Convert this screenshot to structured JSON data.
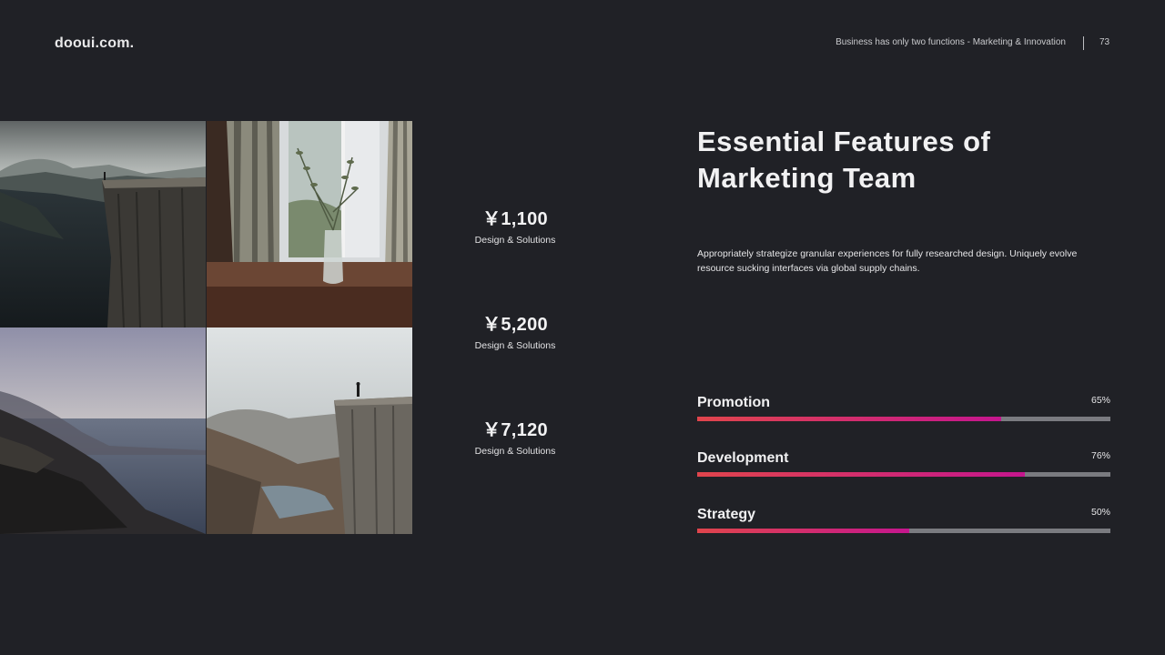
{
  "header": {
    "logo": "dooui.com.",
    "tagline": "Business has only two functions - Marketing & Innovation",
    "page_number": "73"
  },
  "photos": [
    {
      "name": "cliff-lake-photo"
    },
    {
      "name": "window-vase-photo"
    },
    {
      "name": "coast-mountains-photo"
    },
    {
      "name": "cliff-valley-photo"
    }
  ],
  "prices": [
    {
      "amount": "￥1,100",
      "caption": "Design & Solutions"
    },
    {
      "amount": "￥5,200",
      "caption": "Design & Solutions"
    },
    {
      "amount": "￥7,120",
      "caption": "Design & Solutions"
    }
  ],
  "main": {
    "title_line1": "Essential Features of",
    "title_line2": "Marketing Team",
    "description": "Appropriately strategize granular experiences for fully researched design. Uniquely evolve resource sucking interfaces via global supply chains."
  },
  "progress": [
    {
      "label": "Promotion",
      "percent_text": "65%",
      "value": 0.735
    },
    {
      "label": "Development",
      "percent_text": "76%",
      "value": 0.793
    },
    {
      "label": "Strategy",
      "percent_text": "50%",
      "value": 0.513
    }
  ],
  "colors": {
    "background": "#202126",
    "bar_track": "#7a7b80",
    "bar_gradient_start": "#e0454c",
    "bar_gradient_end": "#c5168e"
  }
}
